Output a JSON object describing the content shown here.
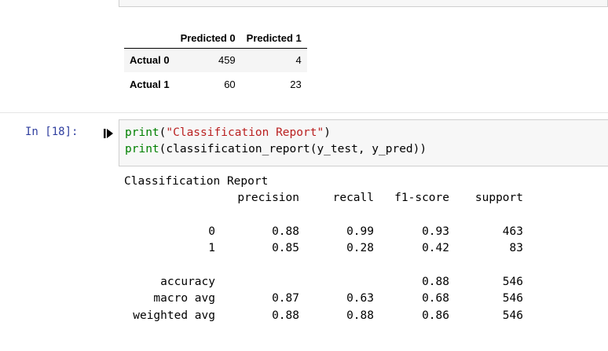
{
  "confusion_df": {
    "columns": [
      "Predicted 0",
      "Predicted 1"
    ],
    "rows": [
      {
        "label": "Actual 0",
        "values": [
          "459",
          "4"
        ]
      },
      {
        "label": "Actual 1",
        "values": [
          "60",
          "23"
        ]
      }
    ]
  },
  "cell": {
    "prompt": "In [18]:",
    "code_line1_fn": "print",
    "code_line1_open": "(",
    "code_line1_str": "\"Classification Report\"",
    "code_line1_close": ")",
    "code_line2_fn": "print",
    "code_line2_rest": "(classification_report(y_test, y_pred))"
  },
  "output": {
    "title": "Classification Report",
    "headers": [
      "precision",
      "recall",
      "f1-score",
      "support"
    ],
    "rows": [
      {
        "label": "0",
        "precision": "0.88",
        "recall": "0.99",
        "f1": "0.93",
        "support": "463"
      },
      {
        "label": "1",
        "precision": "0.85",
        "recall": "0.28",
        "f1": "0.42",
        "support": "83"
      }
    ],
    "summary": [
      {
        "label": "accuracy",
        "precision": "",
        "recall": "",
        "f1": "0.88",
        "support": "546"
      },
      {
        "label": "macro avg",
        "precision": "0.87",
        "recall": "0.63",
        "f1": "0.68",
        "support": "546"
      },
      {
        "label": "weighted avg",
        "precision": "0.88",
        "recall": "0.88",
        "f1": "0.86",
        "support": "546"
      }
    ]
  },
  "colors": {
    "prompt": "#303f9f",
    "builtin": "#008000",
    "string": "#ba2121"
  },
  "icons": {
    "run": "run-cell-icon"
  }
}
